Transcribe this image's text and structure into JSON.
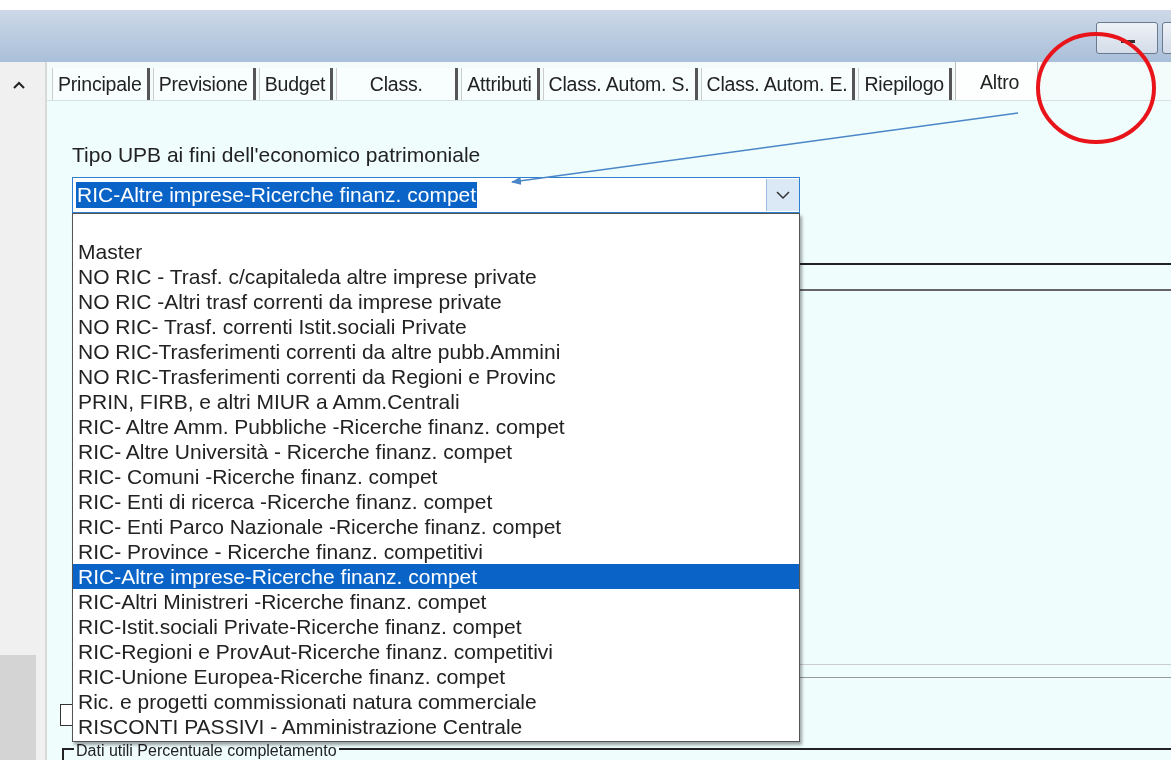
{
  "tabs": [
    {
      "label": "Principale",
      "selected": false
    },
    {
      "label": "Previsione",
      "selected": false
    },
    {
      "label": "Budget",
      "selected": false
    },
    {
      "label": "Class.",
      "selected": false
    },
    {
      "label": "Attributi",
      "selected": false
    },
    {
      "label": "Class. Autom. S.",
      "selected": false
    },
    {
      "label": "Class. Autom. E.",
      "selected": false
    },
    {
      "label": "Riepilogo",
      "selected": false
    },
    {
      "label": "Altro",
      "selected": true
    }
  ],
  "field": {
    "label": "Tipo UPB ai fini dell'economico patrimoniale",
    "value": "RIC-Altre imprese-Ricerche finanz. compet"
  },
  "dropdown": {
    "options": [
      {
        "label": "Master",
        "selected": false
      },
      {
        "label": "NO RIC - Trasf. c/capitaleda altre imprese private",
        "selected": false
      },
      {
        "label": "NO RIC -Altri trasf correnti da imprese private",
        "selected": false
      },
      {
        "label": "NO RIC- Trasf. correnti Istit.sociali Private",
        "selected": false
      },
      {
        "label": "NO RIC-Trasferimenti correnti da altre pubb.Ammini",
        "selected": false
      },
      {
        "label": "NO RIC-Trasferimenti correnti da Regioni e Provinc",
        "selected": false
      },
      {
        "label": "PRIN, FIRB, e altri MIUR a Amm.Centrali",
        "selected": false
      },
      {
        "label": "RIC- Altre Amm. Pubbliche -Ricerche finanz. compet",
        "selected": false
      },
      {
        "label": "RIC- Altre Università - Ricerche finanz. compet",
        "selected": false
      },
      {
        "label": "RIC- Comuni -Ricerche finanz. compet",
        "selected": false
      },
      {
        "label": "RIC- Enti di ricerca -Ricerche finanz. compet",
        "selected": false
      },
      {
        "label": "RIC- Enti Parco Nazionale -Ricerche finanz. compet",
        "selected": false
      },
      {
        "label": "RIC- Province - Ricerche finanz. competitivi",
        "selected": false
      },
      {
        "label": "RIC-Altre imprese-Ricerche finanz. compet",
        "selected": true
      },
      {
        "label": "RIC-Altri Ministreri -Ricerche finanz. compet",
        "selected": false
      },
      {
        "label": "RIC-Istit.sociali Private-Ricerche finanz. compet",
        "selected": false
      },
      {
        "label": "RIC-Regioni e ProvAut-Ricerche finanz. competitivi",
        "selected": false
      },
      {
        "label": "RIC-Unione Europea-Ricerche finanz. compet",
        "selected": false
      },
      {
        "label": "Ric. e progetti commissionati natura commerciale",
        "selected": false
      },
      {
        "label": "RISCONTI PASSIVI - Amministrazione Centrale",
        "selected": false
      }
    ]
  },
  "checkbox": {
    "checked": false
  },
  "group_box": {
    "title": "Dati utili Percentuale completamento"
  }
}
